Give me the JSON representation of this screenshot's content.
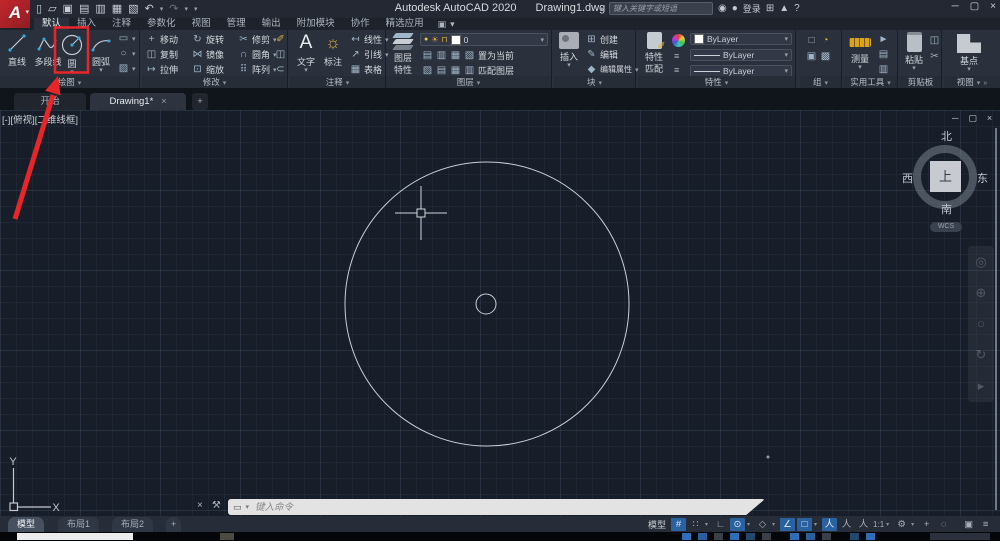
{
  "titlebar": {
    "app_title": "Autodesk AutoCAD 2020",
    "doc_title": "Drawing1.dwg",
    "search_placeholder": "键入关键字或短语",
    "signin": "登录"
  },
  "ribbon_tabs": [
    "默认",
    "插入",
    "注释",
    "参数化",
    "视图",
    "管理",
    "输出",
    "附加模块",
    "协作",
    "精选应用"
  ],
  "panels": {
    "draw": {
      "label": "绘图",
      "line": "直线",
      "polyline": "多段线",
      "circle": "圆",
      "arc": "圆弧"
    },
    "modify": {
      "label": "修改",
      "move": "移动",
      "rotate": "旋转",
      "trim": "修剪",
      "copy": "复制",
      "mirror": "镜像",
      "fillet": "圆角",
      "stretch": "拉伸",
      "scale": "缩放",
      "array": "阵列"
    },
    "annotation": {
      "label": "注释",
      "text": "文字",
      "dimension": "标注",
      "linear": "线性",
      "leader": "引线",
      "table": "表格"
    },
    "layers": {
      "label": "图层",
      "layer_properties_1": "图层",
      "layer_properties_2": "特性",
      "current_layer": "0",
      "set_current": "置为当前",
      "match_layer": "匹配图层"
    },
    "block": {
      "label": "块",
      "insert": "插入",
      "create": "创建",
      "edit": "编辑",
      "edit_attributes": "编辑属性"
    },
    "properties": {
      "label": "特性",
      "match_1": "特性",
      "match_2": "匹配",
      "color": "ByLayer",
      "lineweight": "ByLayer",
      "linetype": "ByLayer"
    },
    "groups": {
      "label": "组"
    },
    "utilities": {
      "label": "实用工具",
      "measure": "测量"
    },
    "clipboard": {
      "label": "剪贴板",
      "paste": "粘贴"
    },
    "view": {
      "label": "视图",
      "base": "基点"
    }
  },
  "file_tabs": {
    "start": "开始",
    "drawing": "Drawing1*"
  },
  "viewport": {
    "label": "[-][俯视][二维线框]",
    "viewcube": {
      "north": "北",
      "south": "南",
      "east": "东",
      "west": "西",
      "top": "上",
      "wcs": "WCS"
    },
    "ucs": {
      "x": "X",
      "y": "Y"
    }
  },
  "command_line": {
    "placeholder": "键入命令"
  },
  "status_bar": {
    "model_tab": "模型",
    "layout1_tab": "布局1",
    "layout2_tab": "布局2",
    "model_label": "模型",
    "annotation_scale": "1:1"
  },
  "highlight": {
    "color": "#e8262a"
  },
  "icons": {
    "logo": "A",
    "caret": "▾",
    "new": "▯",
    "open": "▱",
    "save": "▣",
    "saveas": "▤",
    "plot": "▥",
    "batch": "▦",
    "print": "▧",
    "undo": "↶",
    "redo": "↷",
    "search_go": "▸",
    "binoculars": "◉",
    "user": "●",
    "cart": "⊞",
    "alert": "▲",
    "help": "?",
    "min": "─",
    "restore": "▢",
    "close": "×",
    "screen": "▣",
    "overflow": "»",
    "plus": "+",
    "move": "+",
    "rotate": "↻",
    "trim": "✂",
    "copy": "◫",
    "mirror": "⋈",
    "fillet": "∩",
    "stretch": "↦",
    "scale": "⊡",
    "array": "⠿",
    "erase": "✐",
    "explode": "◫",
    "offset": "⊂",
    "rect": "▭",
    "ellipse": "○",
    "hatch": "▨",
    "text": "A",
    "dim": "☼",
    "linear": "↤",
    "leader": "↗",
    "table": "▦",
    "bulb": "●",
    "sun": "☀",
    "lock": "⊓",
    "l1": "▤",
    "l2": "▥",
    "l3": "▦",
    "l4": "▧",
    "l5": "▨",
    "create": "⊞",
    "edit": "✎",
    "edit_attr": "◆",
    "lines": "≡",
    "g1": "□",
    "g2": "◔",
    "g3": "▣",
    "g4": "▩",
    "u1": "►",
    "u2": "▤",
    "u3": "▥",
    "c1": "◫",
    "c2": "✂",
    "grid": "#",
    "snap": "∷",
    "ortho": "∟",
    "polar": "⊙",
    "iso": "◇",
    "otrack": "∠",
    "osnap": "□",
    "ann": "人",
    "gear": "⚙",
    "isolate": "◌",
    "fullscreen": "▣",
    "hamburger": "≡",
    "wrench": "⚒",
    "cmdwin": "▭",
    "nav1": "◎",
    "nav2": "⊕",
    "nav3": "○",
    "nav4": "↻",
    "nav5": "▸"
  }
}
